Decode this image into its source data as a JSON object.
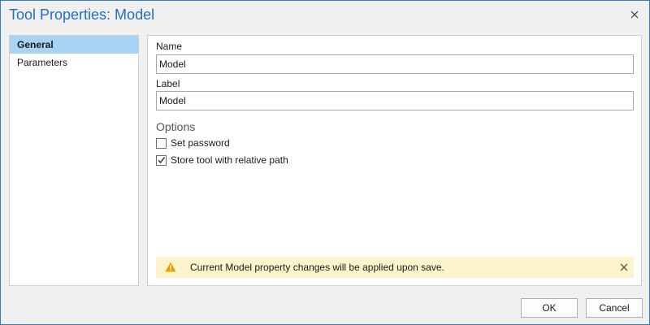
{
  "dialog": {
    "title": "Tool Properties: Model",
    "close_icon": "close-icon"
  },
  "nav": {
    "items": [
      {
        "label": "General",
        "selected": true
      },
      {
        "label": "Parameters",
        "selected": false
      }
    ]
  },
  "general": {
    "name_label": "Name",
    "name_value": "Model",
    "label_label": "Label",
    "label_value": "Model",
    "options_heading": "Options",
    "set_password_label": "Set password",
    "set_password_checked": false,
    "store_relative_label": "Store tool with relative path",
    "store_relative_checked": true
  },
  "notification": {
    "icon": "warning-icon",
    "message": "Current Model property changes will be applied upon save.",
    "close_icon": "close-icon"
  },
  "footer": {
    "ok_label": "OK",
    "cancel_label": "Cancel"
  },
  "colors": {
    "title": "#1f6fc4",
    "nav_selected": "#a9d3f5",
    "banner_bg": "#fcf4cc",
    "warning": "#e8a000"
  }
}
